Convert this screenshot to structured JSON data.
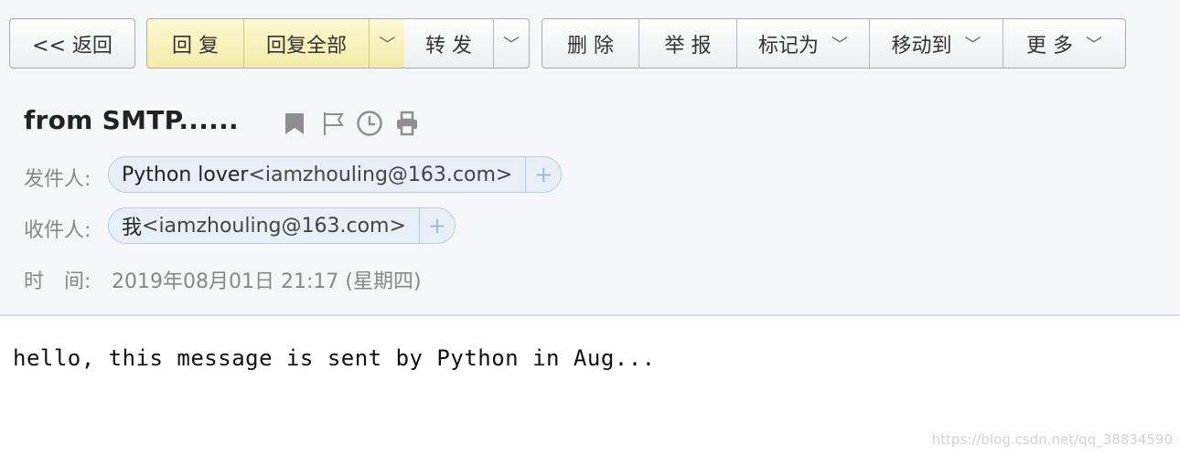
{
  "toolbar": {
    "back": "<< 返回",
    "reply": "回 复",
    "reply_all": "回复全部",
    "forward": "转 发",
    "delete": "删 除",
    "report": "举 报",
    "mark_as": "标记为",
    "move_to": "移动到",
    "more": "更 多",
    "chevron": "﹀"
  },
  "email": {
    "subject": "from SMTP......",
    "sender_label": "发件人:",
    "sender_name": "Python lover",
    "sender_addr": "<iamzhouling@163.com>",
    "recipient_label": "收件人:",
    "recipient_name": "我",
    "recipient_addr": "<iamzhouling@163.com>",
    "time_label": "时　间:",
    "time_value": "2019年08月01日 21:17 (星期四)",
    "body": "hello, this message is sent by Python in Aug...",
    "add_symbol": "+"
  },
  "icons": [
    "bookmark-icon",
    "flag-icon",
    "clock-icon",
    "print-icon"
  ],
  "watermark": "https://blog.csdn.net/qq_38834590"
}
